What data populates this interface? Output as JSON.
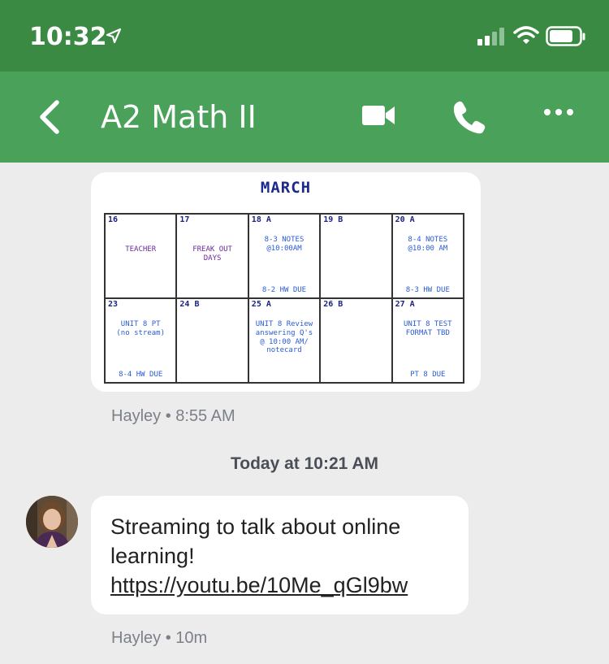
{
  "status": {
    "time": "10:32"
  },
  "nav": {
    "title": "A2 Math II"
  },
  "calendar": {
    "title": "MARCH",
    "cells": [
      {
        "date": "16",
        "notes": [
          "TEACHER"
        ],
        "purple": true
      },
      {
        "date": "17",
        "notes": [
          "FREAK OUT",
          "DAYS"
        ],
        "purple": true
      },
      {
        "date": "18 A",
        "notes": [
          "8-3 NOTES",
          "@10:00AM"
        ],
        "footer": "8-2 HW DUE"
      },
      {
        "date": "19 B",
        "notes": []
      },
      {
        "date": "20 A",
        "notes": [
          "8-4 NOTES",
          "@10:00 AM"
        ],
        "footer": "8-3 HW DUE"
      },
      {
        "date": "23",
        "notes": [
          "UNIT 8 PT",
          "(no stream)"
        ],
        "footer": "8-4 HW DUE"
      },
      {
        "date": "24 B",
        "notes": []
      },
      {
        "date": "25 A",
        "notes": [
          "UNIT 8 Review",
          "answering Q's",
          "@ 10:00 AM/",
          "notecard"
        ]
      },
      {
        "date": "26 B",
        "notes": []
      },
      {
        "date": "27 A",
        "notes": [
          "UNIT 8 TEST",
          "FORMAT TBD"
        ],
        "footer": "PT 8 DUE"
      }
    ]
  },
  "image_meta": "Hayley • 8:55 AM",
  "date_separator": "Today at 10:21 AM",
  "message": {
    "text": "Streaming to talk about online learning!",
    "link": "https://youtu.be/10Me_qGl9bw",
    "meta": "Hayley • 10m"
  },
  "colors": {
    "status_bar": "#3b8a44",
    "nav_bar": "#4aa15a",
    "background": "#ececec"
  }
}
